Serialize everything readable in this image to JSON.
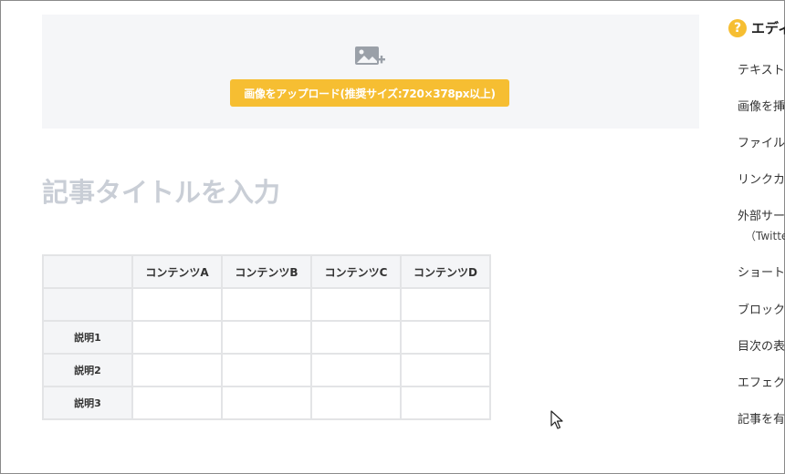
{
  "upload": {
    "icon": "image-add-icon",
    "button_label": "画像をアップロード(推奨サイズ:720×378px以上)"
  },
  "editor": {
    "title_placeholder": "記事タイトルを入力"
  },
  "table": {
    "headers": [
      "",
      "コンテンツA",
      "コンテンツB",
      "コンテンツC",
      "コンテンツD"
    ],
    "rows": [
      {
        "label": "",
        "cells": [
          "",
          "",
          "",
          ""
        ]
      },
      {
        "label": "説明1",
        "cells": [
          "",
          "",
          "",
          ""
        ]
      },
      {
        "label": "説明2",
        "cells": [
          "",
          "",
          "",
          ""
        ]
      },
      {
        "label": "説明3",
        "cells": [
          "",
          "",
          "",
          ""
        ]
      }
    ]
  },
  "sidebar": {
    "help_icon_glyph": "?",
    "title": "エディタ",
    "items": [
      "テキスト",
      "画像を挿",
      "ファイル",
      "リンクカ",
      "外部サー",
      "ショート",
      "ブロック",
      "目次の表",
      "エフェク",
      "記事を有"
    ],
    "item_4_subtext": "（Twitte"
  },
  "colors": {
    "accent": "#f6be32",
    "upload_bg": "#f5f6f8",
    "title_placeholder": "#c9ced6",
    "table_border": "#e3e4e6",
    "table_header_bg": "#f4f5f7"
  }
}
